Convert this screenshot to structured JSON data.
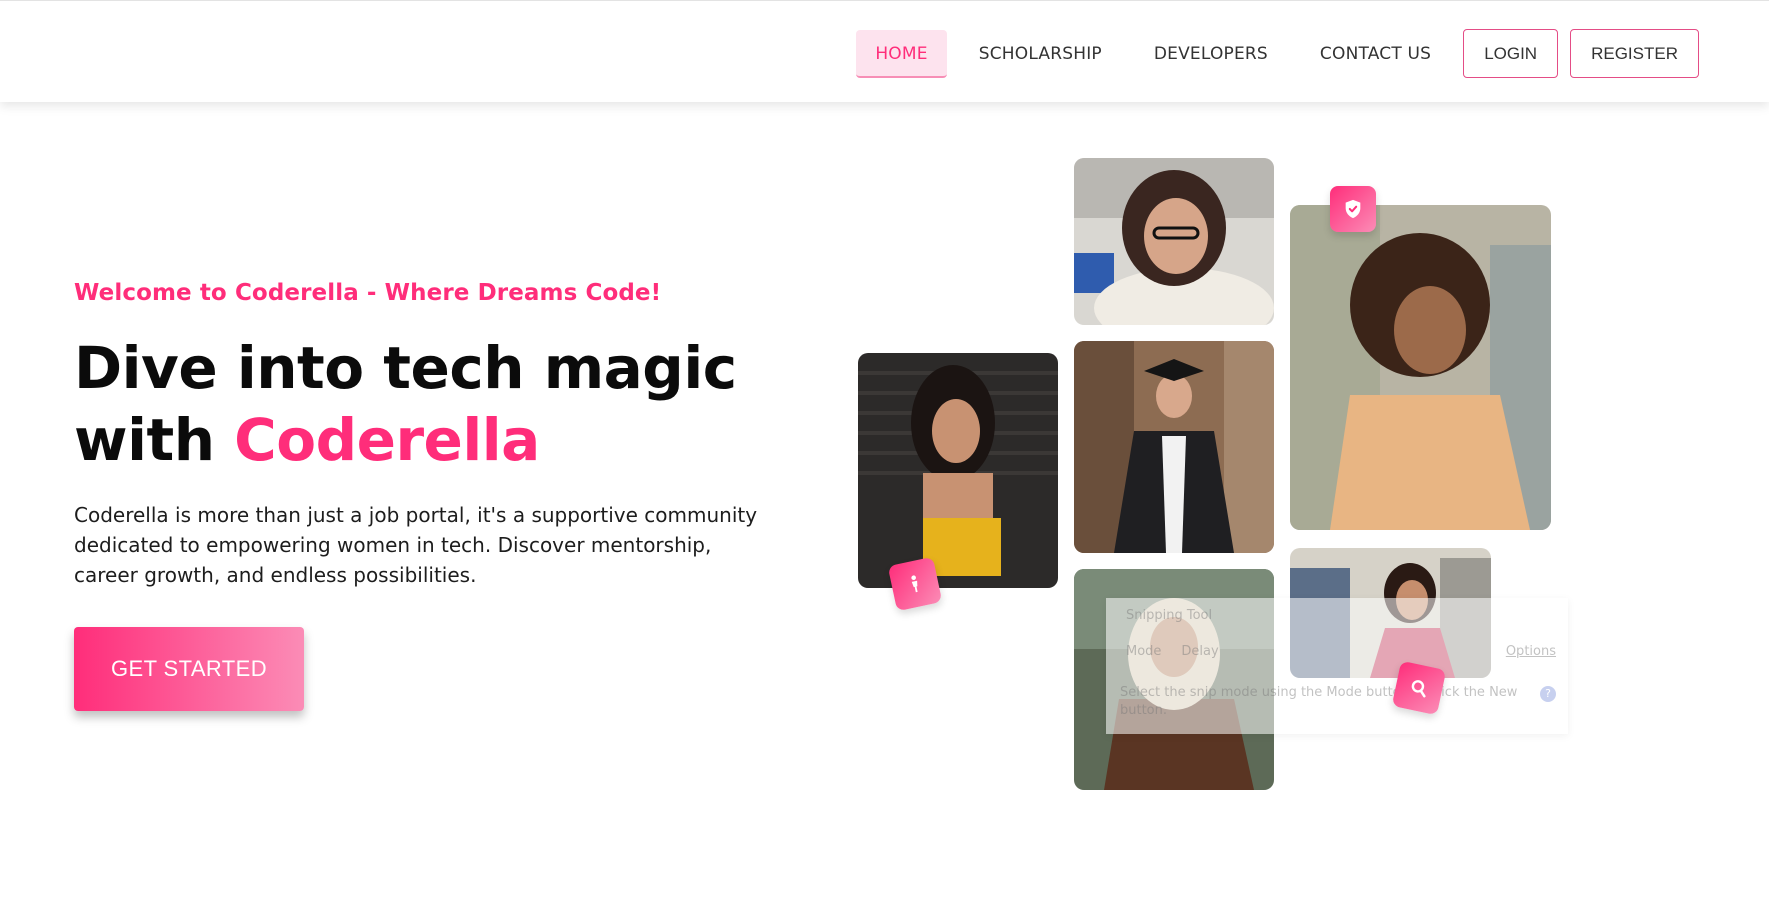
{
  "nav": {
    "links": [
      {
        "label": "HOME",
        "active": true
      },
      {
        "label": "SCHOLARSHIP",
        "active": false
      },
      {
        "label": "DEVELOPERS",
        "active": false
      },
      {
        "label": "CONTACT US",
        "active": false
      }
    ],
    "login_label": "LOGIN",
    "register_label": "REGISTER"
  },
  "hero": {
    "welcome": "Welcome to Coderella - Where Dreams Code!",
    "headline_line1": "Dive into tech magic",
    "headline_line2_prefix": "with ",
    "headline_accent": "Coderella",
    "description": "Coderella is more than just a job portal, it's a supportive community dedicated to empowering women in tech. Discover mentorship, career growth, and endless possibilities.",
    "cta_label": "GET STARTED"
  },
  "badges": {
    "top": "shield-check-icon",
    "left": "person-icon",
    "bottom": "search-icon"
  },
  "snip_overlay": {
    "title": "Snipping Tool",
    "mode_label": "Mode",
    "delay_label": "Delay",
    "options_label": "Options",
    "hint": "Select the snip mode using the Mode button or click the New button."
  },
  "colors": {
    "accent": "#ff2d7a",
    "accent_light": "#fb8cb6",
    "nav_active_bg": "#fde3ee",
    "text": "#0b0b0b"
  }
}
